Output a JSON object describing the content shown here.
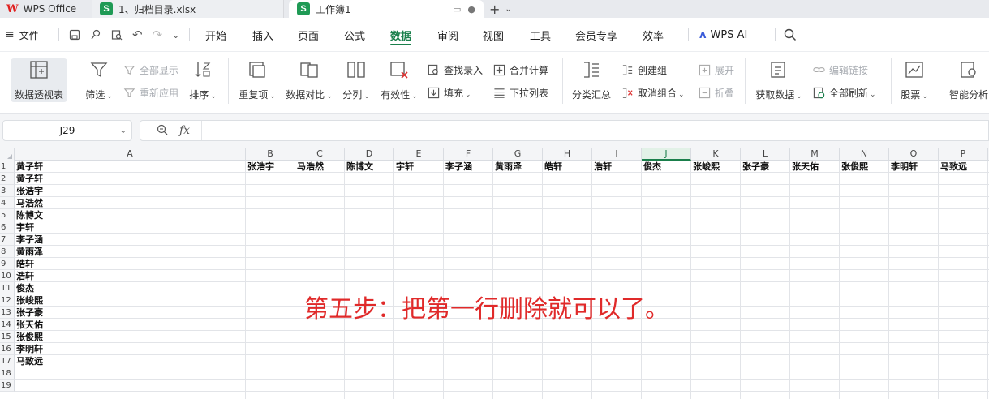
{
  "tabs": {
    "app": "WPS Office",
    "file": "1、归档目录.xlsx",
    "active": "工作簿1"
  },
  "menu": {
    "file_label": "文件",
    "items": [
      "开始",
      "插入",
      "页面",
      "公式",
      "数据",
      "审阅",
      "视图",
      "工具",
      "会员专享",
      "效率"
    ],
    "active": "数据",
    "ai_label": "WPS AI"
  },
  "ribbon": {
    "pivot": "数据透视表",
    "filter": "筛选",
    "show_all": "全部显示",
    "reapply": "重新应用",
    "sort": "排序",
    "duplicates": "重复项",
    "compare": "数据对比",
    "split": "分列",
    "validity": "有效性",
    "find_entry": "查找录入",
    "fill": "填充",
    "merge_calc": "合并计算",
    "dropdown_list": "下拉列表",
    "subtotal": "分类汇总",
    "create_group": "创建组",
    "ungroup": "取消组合",
    "expand": "展开",
    "collapse": "折叠",
    "get_data": "获取数据",
    "edit_links": "编辑链接",
    "refresh_all": "全部刷新",
    "stocks": "股票",
    "smart_analysis": "智能分析"
  },
  "formula": {
    "cell_ref": "J29",
    "fx": "fx",
    "value": ""
  },
  "grid": {
    "columns": [
      "A",
      "B",
      "C",
      "D",
      "E",
      "F",
      "G",
      "H",
      "I",
      "J",
      "K",
      "L",
      "M",
      "N",
      "O",
      "P"
    ],
    "selected_column": "J",
    "rows": [
      "1",
      "2",
      "3",
      "4",
      "5",
      "6",
      "7",
      "8",
      "9",
      "10",
      "11",
      "12",
      "13",
      "14",
      "15",
      "16",
      "17",
      "18",
      "19"
    ],
    "row1": [
      "黄子轩",
      "张浩宇",
      "马浩然",
      "陈博文",
      "宇轩",
      "李子涵",
      "黄雨泽",
      "皓轩",
      "浩轩",
      "俊杰",
      "张峻熙",
      "张子豪",
      "张天佑",
      "张俊熙",
      "李明轩",
      "马致远"
    ],
    "colA": [
      "黄子轩",
      "张浩宇",
      "马浩然",
      "陈博文",
      "宇轩",
      "李子涵",
      "黄雨泽",
      "皓轩",
      "浩轩",
      "俊杰",
      "张峻熙",
      "张子豪",
      "张天佑",
      "张俊熙",
      "李明轩",
      "马致远"
    ]
  },
  "annotation": "第五步：把第一行删除就可以了。"
}
